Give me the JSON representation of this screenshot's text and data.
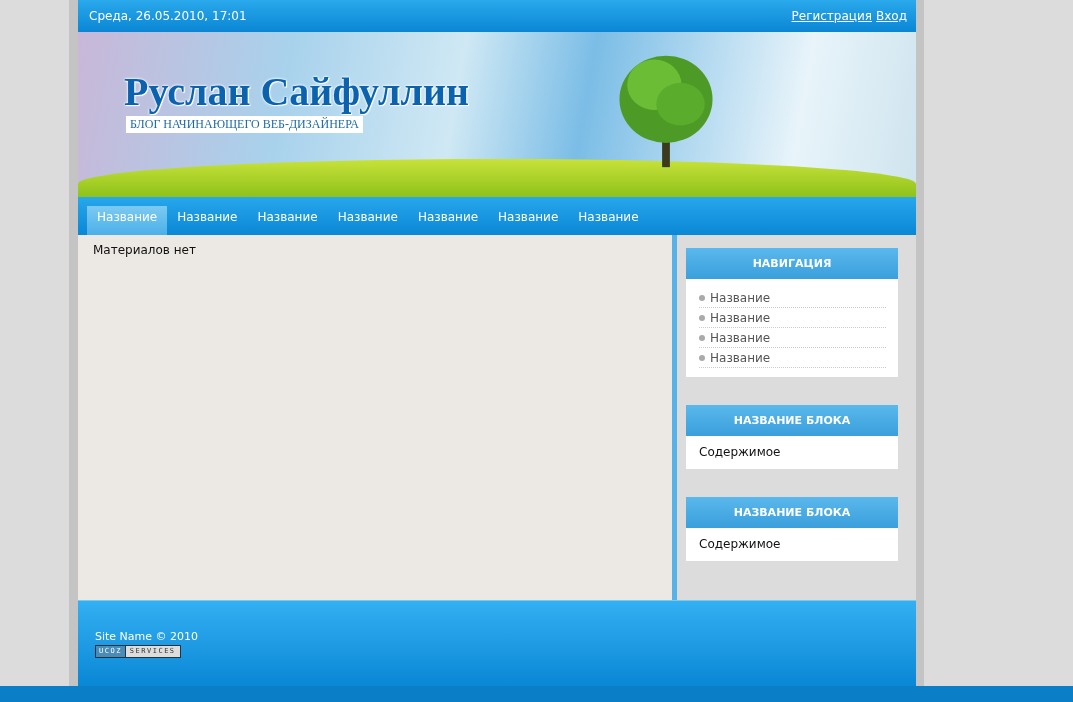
{
  "top_bar": {
    "date": "Среда, 26.05.2010, 17:01",
    "links": [
      "Регистрация",
      "Вход"
    ]
  },
  "header": {
    "title": "Руслан Сайфуллин",
    "tagline": "БЛОГ НАЧИНАЮЩЕГО ВЕБ-ДИЗАЙНЕРА"
  },
  "menu": [
    {
      "label": "Название",
      "selected": true
    },
    {
      "label": "Название",
      "selected": false
    },
    {
      "label": "Название",
      "selected": false
    },
    {
      "label": "Название",
      "selected": false
    },
    {
      "label": "Название",
      "selected": false
    },
    {
      "label": "Название",
      "selected": false
    },
    {
      "label": "Название",
      "selected": false
    }
  ],
  "content": {
    "text": "Материалов нет"
  },
  "sidebar": [
    {
      "kind": "list",
      "title": "НАВИГАЦИЯ",
      "items": [
        "Название",
        "Название",
        "Название",
        "Название"
      ]
    },
    {
      "kind": "text",
      "title": "НАЗВАНИЕ БЛОКА",
      "text": "Содержимое"
    },
    {
      "kind": "text",
      "title": "НАЗВАНИЕ БЛОКА",
      "text": "Содержимое"
    }
  ],
  "footer": {
    "copyright": "Site Name © 2010",
    "badge": [
      "UCOZ",
      "SERVICES"
    ]
  }
}
